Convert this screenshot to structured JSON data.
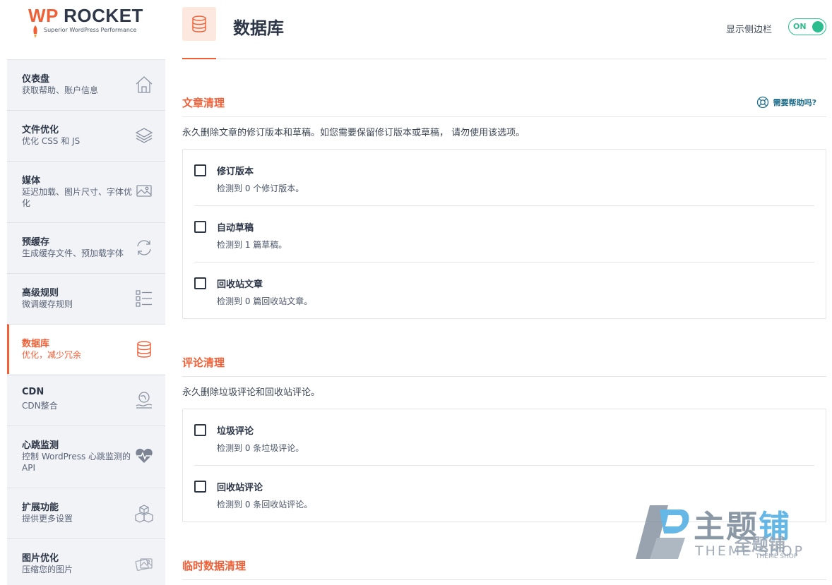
{
  "brand": {
    "logo_prefix": "WP",
    "logo_name": "ROCKET",
    "tagline": "Superior WordPress Performance",
    "accent_color": "#f05f36"
  },
  "sidebar": {
    "items": [
      {
        "title": "仪表盘",
        "desc": "获取帮助、账户信息",
        "icon": "home-icon"
      },
      {
        "title": "文件优化",
        "desc": "优化 CSS 和 JS",
        "icon": "layers-icon"
      },
      {
        "title": "媒体",
        "desc": "延迟加载、图片尺寸、字体优化",
        "icon": "image-icon"
      },
      {
        "title": "预缓存",
        "desc": "生成缓存文件、预加载字体",
        "icon": "refresh-icon"
      },
      {
        "title": "高级规则",
        "desc": "微调缓存规则",
        "icon": "checklist-icon"
      },
      {
        "title": "数据库",
        "desc": "优化，减少冗余",
        "icon": "database-icon",
        "active": true
      },
      {
        "title": "CDN",
        "desc": "CDN整合",
        "icon": "globe-hand-icon"
      },
      {
        "title": "心跳监测",
        "desc": "控制 WordPress 心跳监测的 API",
        "icon": "heartbeat-icon"
      },
      {
        "title": "扩展功能",
        "desc": "提供更多设置",
        "icon": "cubes-icon"
      },
      {
        "title": "图片优化",
        "desc": "压缩您的图片",
        "icon": "photos-icon"
      }
    ]
  },
  "header": {
    "title": "数据库",
    "icon": "database-icon",
    "sidebar_toggle_label": "显示侧边栏",
    "toggle_state": "ON",
    "toggle_color": "#2bbd8d"
  },
  "sections": [
    {
      "title": "文章清理",
      "help": "需要帮助吗?",
      "desc": "永久删除文章的修订版本和草稿。如您需要保留修订版本或草稿， 请勿使用该选项。",
      "options": [
        {
          "label": "修订版本",
          "count": "检测到 0 个修订版本。"
        },
        {
          "label": "自动草稿",
          "count": "检测到 1 篇草稿。"
        },
        {
          "label": "回收站文章",
          "count": "检测到 0 篇回收站文章。"
        }
      ]
    },
    {
      "title": "评论清理",
      "desc": "永久删除垃圾评论和回收站评论。",
      "options": [
        {
          "label": "垃圾评论",
          "count": "检测到 0 条垃圾评论。"
        },
        {
          "label": "回收站评论",
          "count": "检测到 0 条回收站评论。"
        }
      ]
    },
    {
      "title": "临时数据清理"
    }
  ],
  "watermark": {
    "main_gray": "主题",
    "main_blue": "铺",
    "sub": "THEME SHOP",
    "small": "全题铺",
    "small_sub": "THEME SHOP"
  }
}
